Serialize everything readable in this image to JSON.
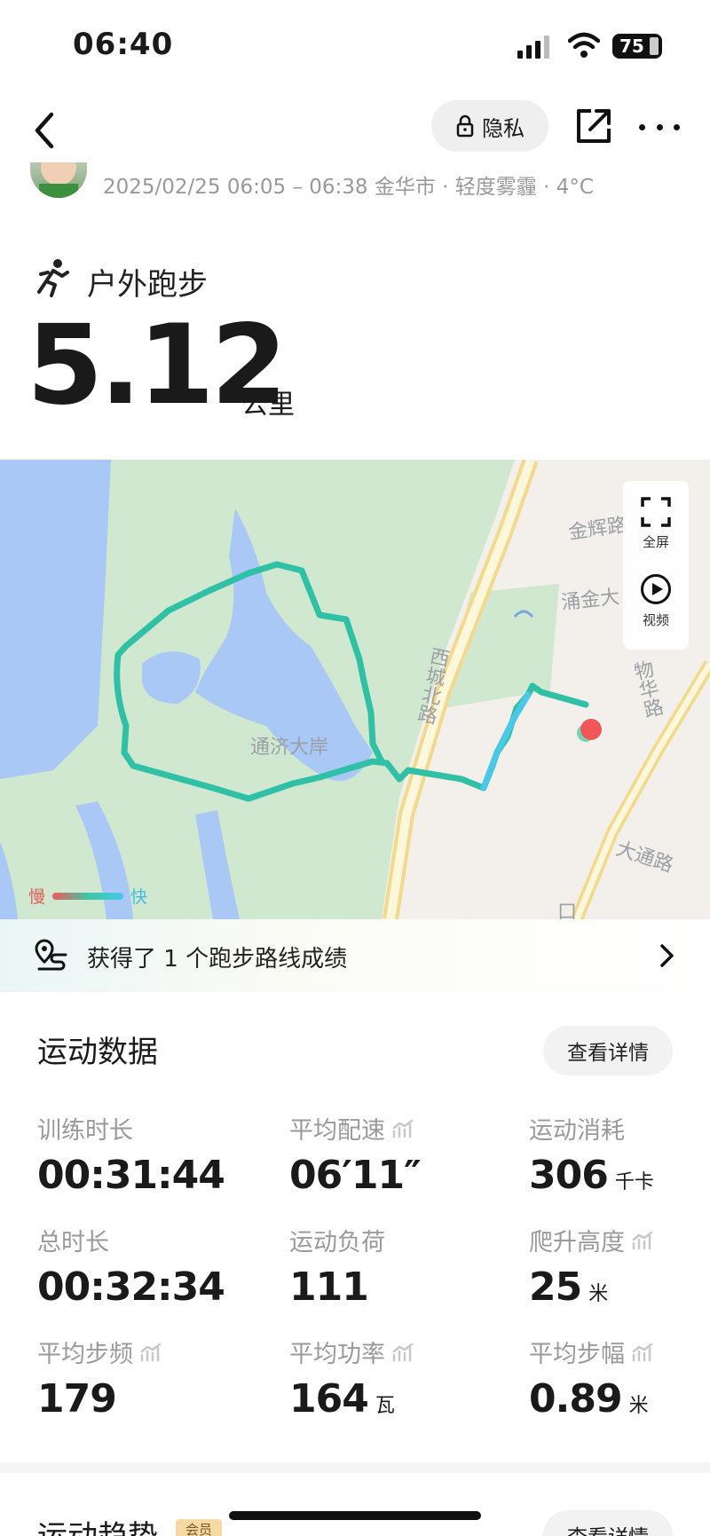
{
  "status_bar": {
    "time": "06:40",
    "battery": "75"
  },
  "header": {
    "privacy_label": "隐私",
    "meta": "2025/02/25 06:05 – 06:38 金华市 · 轻度雾霾 · 4°C"
  },
  "workout": {
    "type": "户外跑步",
    "distance": "5.12",
    "distance_unit": "公里"
  },
  "map": {
    "labels": {
      "lake": "通济大岸",
      "road_jinhui": "金辉路",
      "road_yongjin": "涌金大",
      "road_xicheng": "西城北路",
      "road_wuhua": "物华路",
      "road_datong": "大通路",
      "road_other": "口"
    },
    "fullscreen_label": "全屏",
    "video_label": "视频",
    "legend_slow": "慢",
    "legend_fast": "快"
  },
  "route_banner": {
    "text": "获得了 1 个跑步路线成绩"
  },
  "sport_data": {
    "title": "运动数据",
    "detail_label": "查看详情",
    "metrics": [
      {
        "label": "训练时长",
        "value": "00:31:44",
        "unit": ""
      },
      {
        "label": "平均配速",
        "value": "06′11″",
        "unit": ""
      },
      {
        "label": "运动消耗",
        "value": "306",
        "unit": "千卡"
      },
      {
        "label": "总时长",
        "value": "00:32:34",
        "unit": ""
      },
      {
        "label": "运动负荷",
        "value": "111",
        "unit": ""
      },
      {
        "label": "爬升高度",
        "value": "25",
        "unit": "米"
      },
      {
        "label": "平均步频",
        "value": "179",
        "unit": ""
      },
      {
        "label": "平均功率",
        "value": "164",
        "unit": "瓦"
      },
      {
        "label": "平均步幅",
        "value": "0.89",
        "unit": "米"
      }
    ]
  },
  "trend": {
    "title": "运动趋势",
    "badge": "会员",
    "detail_label": "查看详情"
  }
}
